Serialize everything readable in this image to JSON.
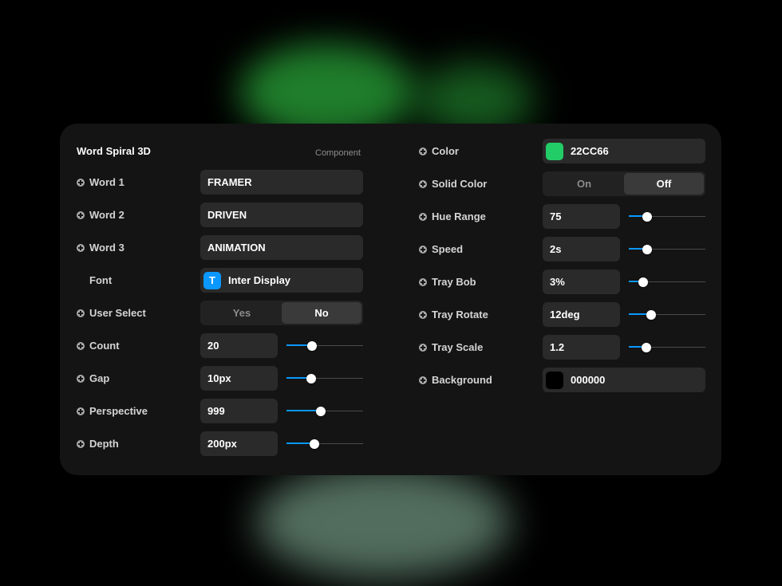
{
  "panel": {
    "title": "Word Spiral 3D",
    "subtitle": "Component"
  },
  "left": {
    "word1": {
      "label": "Word 1",
      "value": "FRAMER"
    },
    "word2": {
      "label": "Word 2",
      "value": "DRIVEN"
    },
    "word3": {
      "label": "Word 3",
      "value": "ANIMATION"
    },
    "font": {
      "label": "Font",
      "value": "Inter Display",
      "icon": "T"
    },
    "user_select": {
      "label": "User Select",
      "options": [
        "Yes",
        "No"
      ],
      "selected": "No"
    },
    "count": {
      "label": "Count",
      "value": "20",
      "slider": 0.33
    },
    "gap": {
      "label": "Gap",
      "value": "10px",
      "slider": 0.32
    },
    "perspective": {
      "label": "Perspective",
      "value": "999",
      "slider": 0.45
    },
    "depth": {
      "label": "Depth",
      "value": "200px",
      "slider": 0.36
    }
  },
  "right": {
    "color": {
      "label": "Color",
      "value": "22CC66",
      "swatch": "#22CC66"
    },
    "solid_color": {
      "label": "Solid Color",
      "options": [
        "On",
        "Off"
      ],
      "selected": "Off"
    },
    "hue_range": {
      "label": "Hue Range",
      "value": "75",
      "slider": 0.24
    },
    "speed": {
      "label": "Speed",
      "value": "2s",
      "slider": 0.24
    },
    "tray_bob": {
      "label": "Tray Bob",
      "value": "3%",
      "slider": 0.19
    },
    "tray_rotate": {
      "label": "Tray Rotate",
      "value": "12deg",
      "slider": 0.29
    },
    "tray_scale": {
      "label": "Tray Scale",
      "value": "1.2",
      "slider": 0.23
    },
    "background": {
      "label": "Background",
      "value": "000000",
      "swatch": "#000000"
    }
  },
  "colors": {
    "accent": "#0A98FF",
    "panel_bg": "#141414",
    "field_bg": "#2A2A2A"
  }
}
